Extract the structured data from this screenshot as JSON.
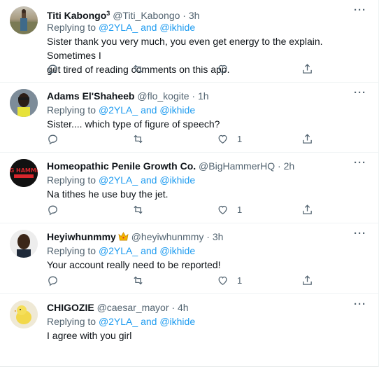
{
  "tweets": [
    {
      "name": "Titi Kabongo",
      "name_sup": "3",
      "handle": "@Titi_Kabongo",
      "dot": "·",
      "time": "3h",
      "replying_prefix": "Replying to",
      "mention1": "@2YLA_",
      "and": "and",
      "mention2": "@ikhide",
      "text_lines": [
        "Sister thank you very much, you even get energy to the explain. Sometimes I",
        "get tired of reading comments on this app."
      ],
      "like_count": ""
    },
    {
      "name": "Adams El'Shaheeb",
      "handle": "@flo_kogite",
      "dot": "·",
      "time": "1h",
      "replying_prefix": "Replying to",
      "mention1": "@2YLA_",
      "and": "and",
      "mention2": "@ikhide",
      "text_lines": [
        "Sister.... which type of figure of speech?"
      ],
      "like_count": "1"
    },
    {
      "name": "Homeopathic Penile Growth Co.",
      "handle": "@BigHammerHQ",
      "dot": "·",
      "time": "2h",
      "replying_prefix": "Replying to",
      "mention1": "@2YLA_",
      "and": "and",
      "mention2": "@ikhide",
      "text_lines": [
        "Na tithes he use buy the jet."
      ],
      "like_count": "1",
      "avatar_text": "BIG HAMMER"
    },
    {
      "name": "Heyiwhunmmy",
      "handle": "@heyiwhunmmy",
      "dot": "·",
      "time": "3h",
      "replying_prefix": "Replying to",
      "mention1": "@2YLA_",
      "and": "and",
      "mention2": "@ikhide",
      "text_lines": [
        "Your account really need to be reported!"
      ],
      "like_count": "1"
    },
    {
      "name": "CHIGOZIE",
      "handle": "@caesar_mayor",
      "dot": "·",
      "time": "4h",
      "replying_prefix": "Replying to",
      "mention1": "@2YLA_",
      "and": "and",
      "mention2": "@ikhide",
      "text_lines": [
        "I agree with you girl"
      ],
      "like_count": ""
    }
  ],
  "icons": {
    "more": "more-horizontal-icon",
    "reply": "reply-bubble-icon",
    "retweet": "retweet-icon",
    "like": "heart-icon",
    "share": "share-upload-icon",
    "crown": "crown-emoji-icon"
  },
  "colors": {
    "link": "#1d9bf0",
    "secondary_text": "#536471",
    "primary_text": "#0f1419",
    "divider": "#eff3f4"
  }
}
